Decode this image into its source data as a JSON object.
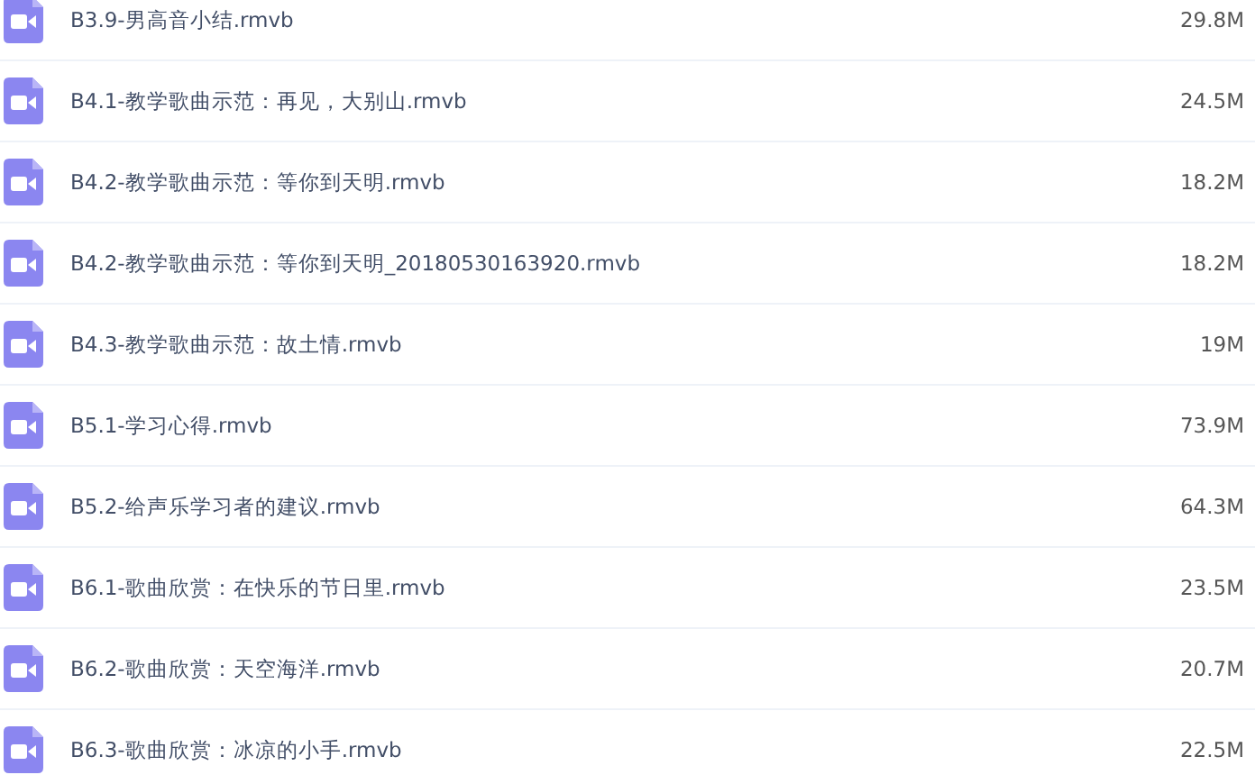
{
  "files": [
    {
      "name": "B3.9-男高音小结.rmvb",
      "size": "29.8M"
    },
    {
      "name": "B4.1-教学歌曲示范：再见，大别山.rmvb",
      "size": "24.5M"
    },
    {
      "name": "B4.2-教学歌曲示范：等你到天明.rmvb",
      "size": "18.2M"
    },
    {
      "name": "B4.2-教学歌曲示范：等你到天明_20180530163920.rmvb",
      "size": "18.2M"
    },
    {
      "name": "B4.3-教学歌曲示范：故土情.rmvb",
      "size": "19M"
    },
    {
      "name": "B5.1-学习心得.rmvb",
      "size": "73.9M"
    },
    {
      "name": "B5.2-给声乐学习者的建议.rmvb",
      "size": "64.3M"
    },
    {
      "name": "B6.1-歌曲欣赏：在快乐的节日里.rmvb",
      "size": "23.5M"
    },
    {
      "name": "B6.2-歌曲欣赏：天空海洋.rmvb",
      "size": "20.7M"
    },
    {
      "name": "B6.3-歌曲欣赏：冰凉的小手.rmvb",
      "size": "22.5M"
    }
  ]
}
